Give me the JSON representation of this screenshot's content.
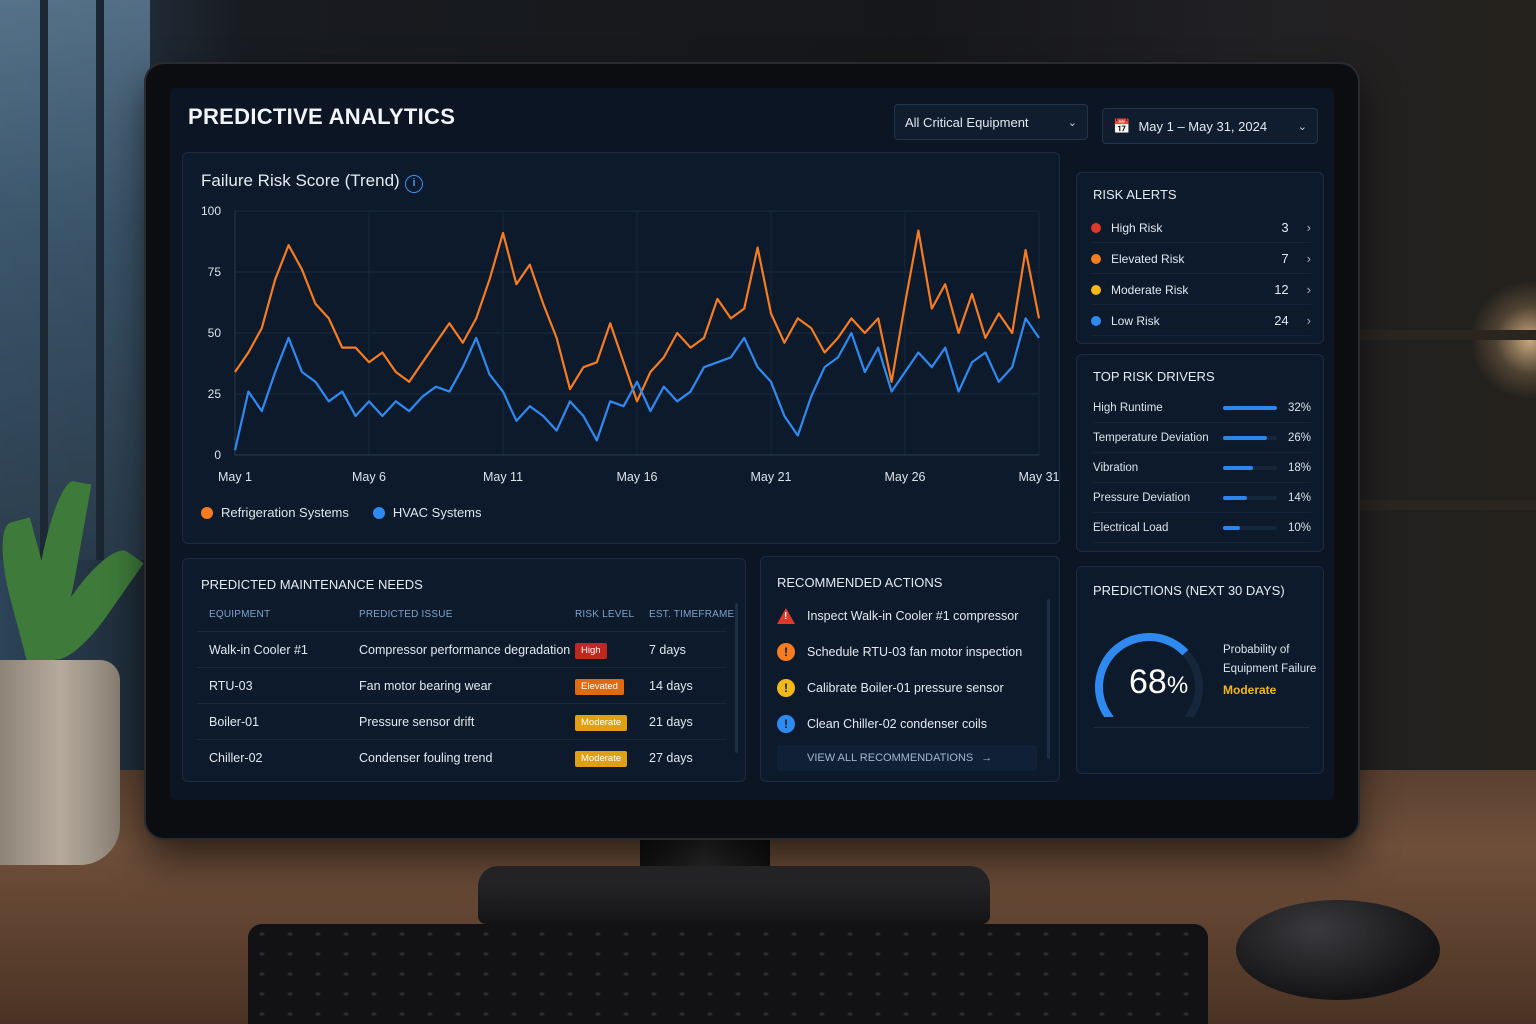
{
  "header": {
    "title": "PREDICTIVE ANALYTICS",
    "equipment_filter": "All Critical Equipment",
    "date_range": "May 1 – May 31, 2024"
  },
  "chart": {
    "title": "Failure Risk Score (Trend)",
    "legend": [
      "Refrigeration Systems",
      "HVAC Systems"
    ]
  },
  "chart_data": {
    "type": "line",
    "title": "Failure Risk Score (Trend)",
    "xlabel": "",
    "ylabel": "",
    "ylim": [
      0,
      100
    ],
    "yticks": [
      0,
      25,
      50,
      75,
      100
    ],
    "x": [
      1,
      1.5,
      2,
      2.5,
      3,
      3.5,
      4,
      4.5,
      5,
      5.5,
      6,
      6.5,
      7,
      7.5,
      8,
      8.5,
      9,
      9.5,
      10,
      10.5,
      11,
      11.5,
      12,
      12.5,
      13,
      13.5,
      14,
      14.5,
      15,
      15.5,
      16,
      16.5,
      17,
      17.5,
      18,
      18.5,
      19,
      19.5,
      20,
      20.5,
      21,
      21.5,
      22,
      22.5,
      23,
      23.5,
      24,
      24.5,
      25,
      25.5,
      26,
      26.5,
      27,
      27.5,
      28,
      28.5,
      29,
      29.5,
      30,
      30.5,
      31
    ],
    "xticks": [
      "May 1",
      "May 6",
      "May 11",
      "May 16",
      "May 21",
      "May 26",
      "May 31"
    ],
    "xtick_values": [
      1,
      6,
      11,
      16,
      21,
      26,
      31
    ],
    "grid": true,
    "legend_position": "bottom-left",
    "series": [
      {
        "name": "Refrigeration Systems",
        "color": "#f57c20",
        "values": [
          34,
          42,
          52,
          72,
          86,
          76,
          62,
          56,
          44,
          44,
          38,
          42,
          34,
          30,
          38,
          46,
          54,
          46,
          56,
          72,
          91,
          70,
          78,
          62,
          48,
          27,
          36,
          38,
          54,
          38,
          22,
          34,
          40,
          50,
          44,
          48,
          64,
          56,
          60,
          85,
          58,
          46,
          56,
          52,
          42,
          48,
          56,
          50,
          56,
          30,
          62,
          92,
          60,
          70,
          50,
          66,
          48,
          58,
          50,
          84,
          56
        ]
      },
      {
        "name": "HVAC Systems",
        "color": "#2f8af0",
        "values": [
          2,
          26,
          18,
          34,
          48,
          34,
          30,
          22,
          26,
          16,
          22,
          16,
          22,
          18,
          24,
          28,
          26,
          36,
          48,
          33,
          26,
          14,
          20,
          16,
          10,
          22,
          16,
          6,
          22,
          20,
          30,
          18,
          28,
          22,
          26,
          36,
          38,
          40,
          48,
          36,
          30,
          16,
          8,
          24,
          36,
          40,
          50,
          34,
          44,
          26,
          34,
          42,
          36,
          44,
          26,
          38,
          42,
          30,
          36,
          56,
          48
        ]
      }
    ]
  },
  "risk_alerts": {
    "title": "RISK ALERTS",
    "items": [
      {
        "label": "High Risk",
        "count": "3",
        "color": "#e0392b"
      },
      {
        "label": "Elevated Risk",
        "count": "7",
        "color": "#f57c20"
      },
      {
        "label": "Moderate Risk",
        "count": "12",
        "color": "#f1b81a"
      },
      {
        "label": "Low Risk",
        "count": "24",
        "color": "#2f8af0"
      }
    ]
  },
  "risk_drivers": {
    "title": "TOP RISK DRIVERS",
    "items": [
      {
        "label": "High Runtime",
        "pct": "32%",
        "value": 32
      },
      {
        "label": "Temperature Deviation",
        "pct": "26%",
        "value": 26
      },
      {
        "label": "Vibration",
        "pct": "18%",
        "value": 18
      },
      {
        "label": "Pressure Deviation",
        "pct": "14%",
        "value": 14
      },
      {
        "label": "Electrical Load",
        "pct": "10%",
        "value": 10
      }
    ]
  },
  "maintenance": {
    "title": "PREDICTED MAINTENANCE NEEDS",
    "columns": [
      "EQUIPMENT",
      "PREDICTED ISSUE",
      "RISK LEVEL",
      "EST. TIMEFRAME"
    ],
    "rows": [
      {
        "equipment": "Walk-in Cooler #1",
        "issue": "Compressor performance degradation",
        "risk": "High",
        "risk_color": "#c0281e",
        "timeframe": "7 days"
      },
      {
        "equipment": "RTU-03",
        "issue": "Fan motor bearing wear",
        "risk": "Elevated",
        "risk_color": "#e06a10",
        "timeframe": "14 days"
      },
      {
        "equipment": "Boiler-01",
        "issue": "Pressure sensor drift",
        "risk": "Moderate",
        "risk_color": "#e0a012",
        "timeframe": "21 days"
      },
      {
        "equipment": "Chiller-02",
        "issue": "Condenser fouling trend",
        "risk": "Moderate",
        "risk_color": "#e0a012",
        "timeframe": "27 days"
      }
    ]
  },
  "actions": {
    "title": "RECOMMENDED ACTIONS",
    "items": [
      {
        "label": "Inspect Walk-in Cooler #1 compressor",
        "icon": "warning-triangle-icon",
        "color": "#e0392b"
      },
      {
        "label": "Schedule RTU-03 fan motor inspection",
        "icon": "alert-circle-icon",
        "color": "#f57c20"
      },
      {
        "label": "Calibrate Boiler-01 pressure sensor",
        "icon": "alert-circle-icon",
        "color": "#f1b81a"
      },
      {
        "label": "Clean Chiller-02 condenser coils",
        "icon": "alert-circle-icon",
        "color": "#2f8af0"
      }
    ],
    "view_all": "VIEW ALL RECOMMENDATIONS"
  },
  "predictions": {
    "title": "PREDICTIONS (NEXT 30 DAYS)",
    "value": "68",
    "unit": "%",
    "fraction": 0.68,
    "label": "Probability of Equipment Failure",
    "status": "Moderate"
  }
}
